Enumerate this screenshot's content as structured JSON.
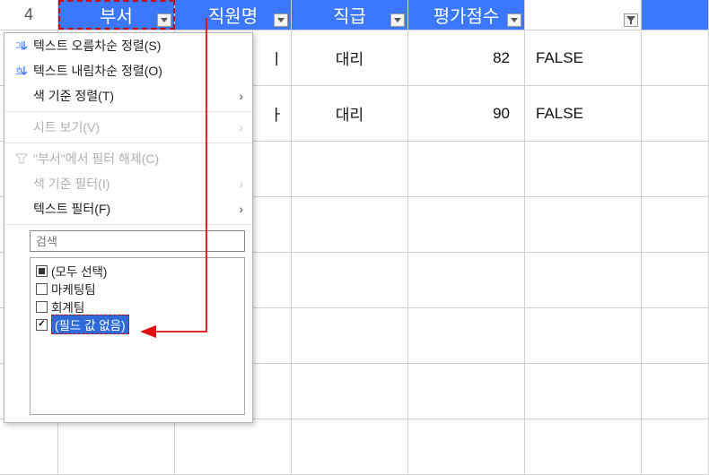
{
  "row_number": "4",
  "headers": {
    "dept": "부서",
    "name": "직원명",
    "rank": "직급",
    "score": "평가점수",
    "extra": ""
  },
  "chart_data": {
    "type": "table",
    "columns": [
      "부서",
      "직원명",
      "직급",
      "평가점수",
      ""
    ],
    "rows": [
      {
        "dept": "",
        "name_suffix": "ㅣ",
        "rank": "대리",
        "score": 82,
        "extra": "FALSE"
      },
      {
        "dept": "",
        "name_suffix": "ㅏ",
        "rank": "대리",
        "score": 90,
        "extra": "FALSE"
      }
    ]
  },
  "dropdown": {
    "sort_asc": "텍스트 오름차순 정렬(S)",
    "sort_desc": "텍스트 내림차순 정렬(O)",
    "sort_by_color": "색 기준 정렬(T)",
    "sheet_view": "시트 보기(V)",
    "clear_filter": "\"부서\"에서 필터 해제(C)",
    "filter_by_color": "색 기준 필터(I)",
    "text_filter": "텍스트 필터(F)",
    "search_placeholder": "검색",
    "options": {
      "select_all": "(모두 선택)",
      "opt1": "마케팅팀",
      "opt2": "회계팀",
      "opt_blank": "(필드 값 없음)"
    }
  }
}
